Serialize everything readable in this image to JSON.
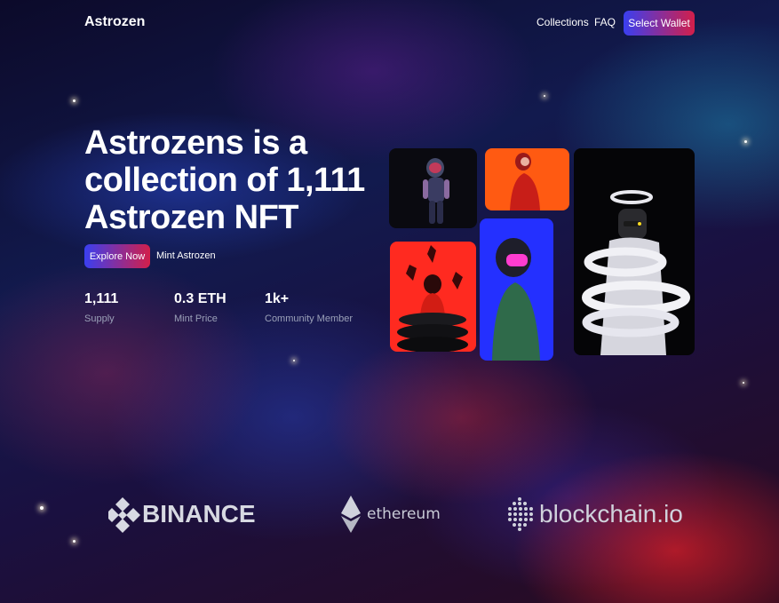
{
  "nav": {
    "brand": "Astrozen",
    "links": [
      "Collections",
      "FAQ"
    ],
    "wallet_button": "Select Wallet"
  },
  "hero": {
    "title": "Astrozens is a collection of 1,111 Astrozen NFT",
    "explore_button": "Explore Now",
    "mint_link": "Mint Astrozen"
  },
  "stats": [
    {
      "value": "1,111",
      "label": "Supply"
    },
    {
      "value": "0.3 ETH",
      "label": "Mint Price"
    },
    {
      "value": "1k+",
      "label": "Community Member"
    }
  ],
  "gallery": [
    {
      "name": "astronaut-figure-dark",
      "bg": "#0a0a10"
    },
    {
      "name": "astronaut-figure-orange",
      "bg": "#ff5a12"
    },
    {
      "name": "astronaut-figure-halo",
      "bg": "#050507"
    },
    {
      "name": "astronaut-figure-red-rings",
      "bg": "#ff2a20"
    },
    {
      "name": "astronaut-figure-blue-pink-visor",
      "bg": "#2430ff"
    }
  ],
  "partners": [
    "BINANCE",
    "ethereum",
    "blockchain.io"
  ],
  "colors": {
    "accent_start": "#3a3ff0",
    "accent_end": "#d21f4a",
    "muted_text": "#9aa0b8"
  }
}
